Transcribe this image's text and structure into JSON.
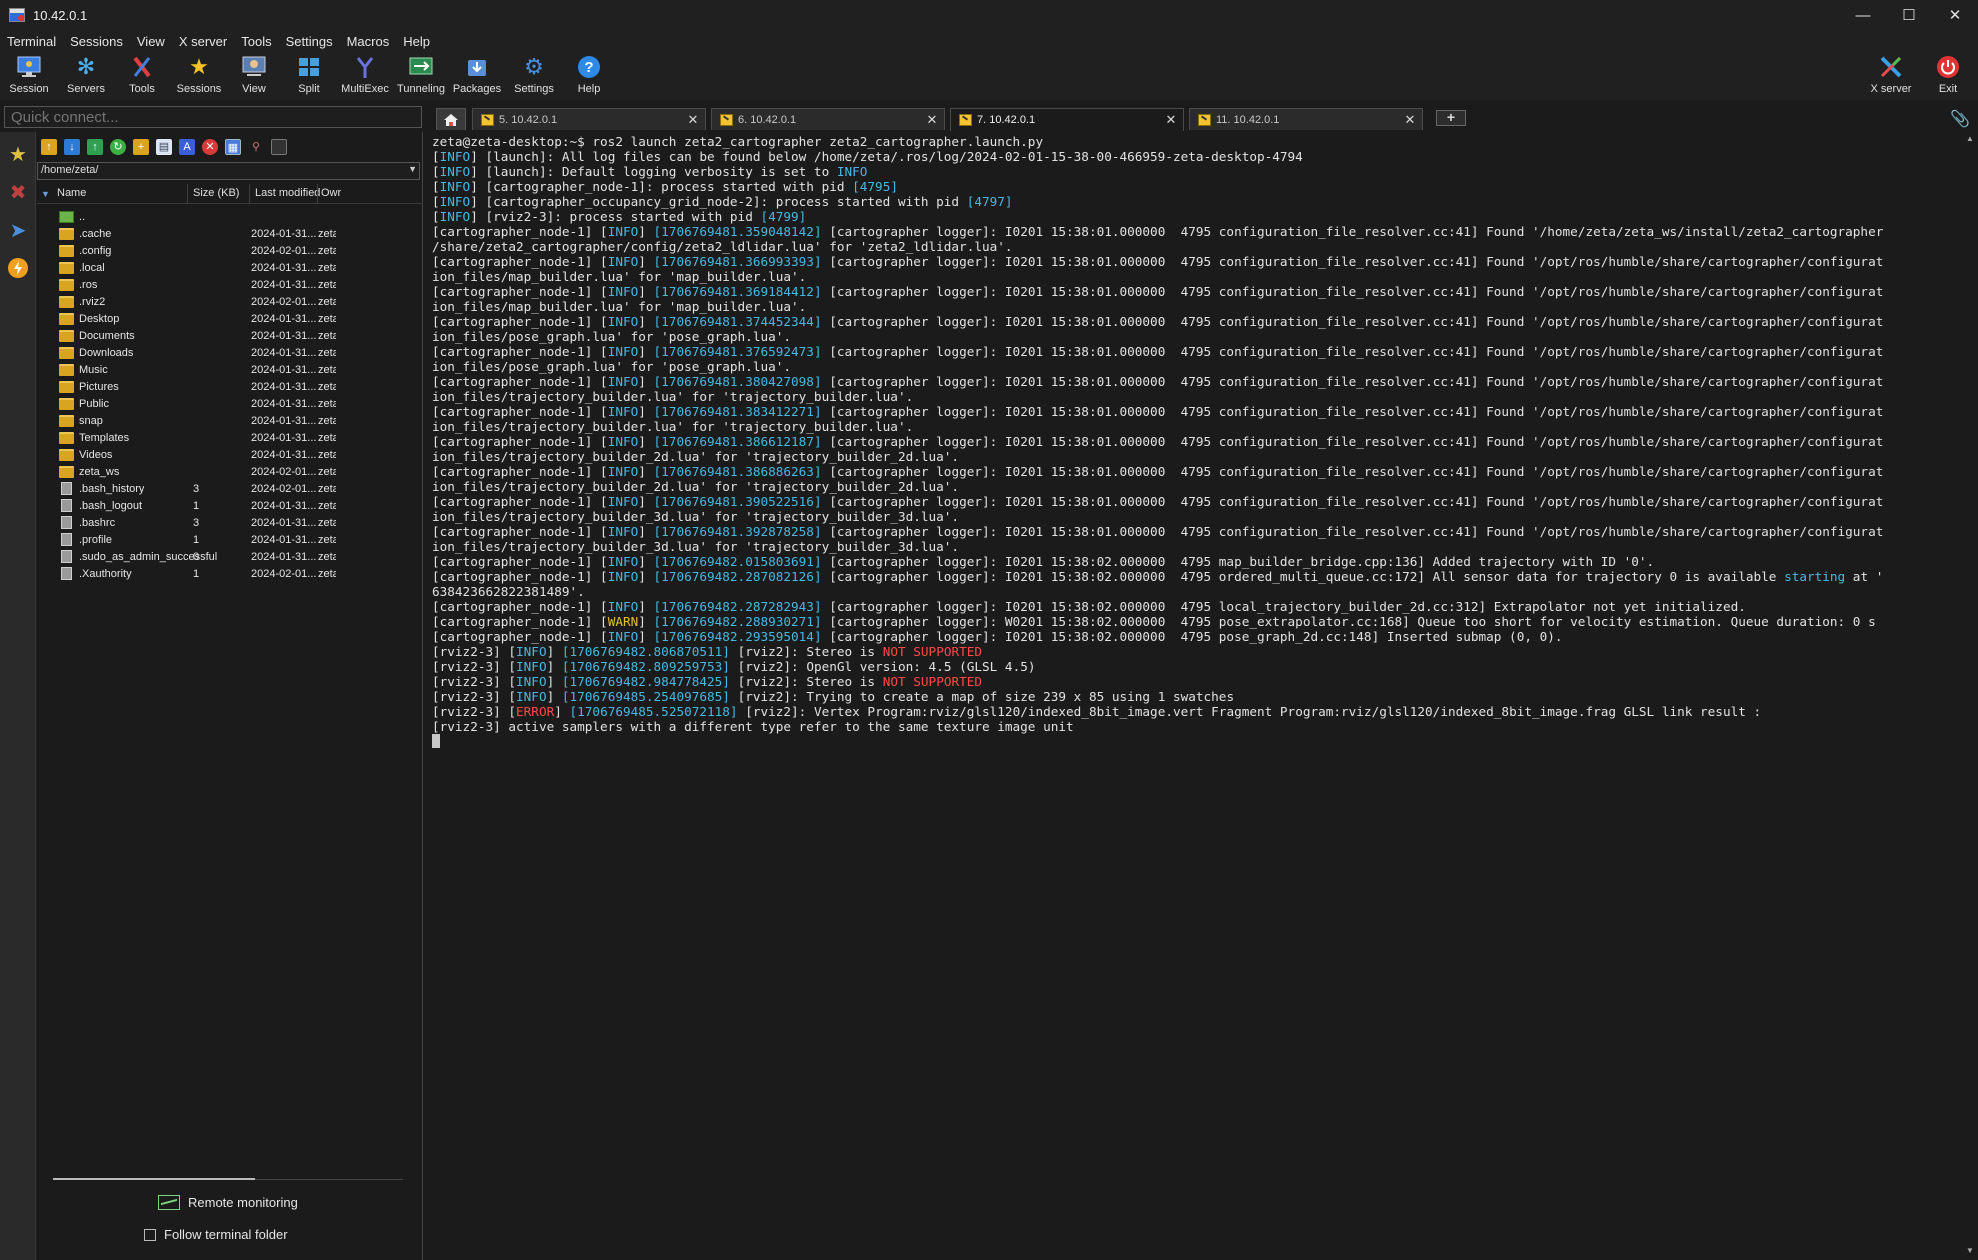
{
  "window": {
    "title": "10.42.0.1"
  },
  "menubar": [
    "Terminal",
    "Sessions",
    "View",
    "X server",
    "Tools",
    "Settings",
    "Macros",
    "Help"
  ],
  "toolbar": {
    "buttons": [
      {
        "label": "Session"
      },
      {
        "label": "Servers"
      },
      {
        "label": "Tools"
      },
      {
        "label": "Sessions"
      },
      {
        "label": "View"
      },
      {
        "label": "Split"
      },
      {
        "label": "MultiExec"
      },
      {
        "label": "Tunneling"
      },
      {
        "label": "Packages"
      },
      {
        "label": "Settings"
      },
      {
        "label": "Help"
      }
    ],
    "right_buttons": [
      {
        "label": "X server"
      },
      {
        "label": "Exit"
      }
    ]
  },
  "quick_connect": {
    "placeholder": "Quick connect..."
  },
  "tabs": [
    {
      "label": "5. 10.42.0.1",
      "active": false
    },
    {
      "label": "6. 10.42.0.1",
      "active": false
    },
    {
      "label": "7. 10.42.0.1",
      "active": true
    },
    {
      "label": "11. 10.42.0.1",
      "active": false
    }
  ],
  "sftp": {
    "path": "/home/zeta/",
    "columns": {
      "name": "Name",
      "size": "Size (KB)",
      "modified": "Last modified",
      "owner": "Owr"
    },
    "files": [
      {
        "name": "..",
        "size": "",
        "modified": "",
        "owner": "",
        "type": "up"
      },
      {
        "name": ".cache",
        "size": "",
        "modified": "2024-01-31...",
        "owner": "zeta",
        "type": "folder"
      },
      {
        "name": ".config",
        "size": "",
        "modified": "2024-02-01...",
        "owner": "zeta",
        "type": "folder"
      },
      {
        "name": ".local",
        "size": "",
        "modified": "2024-01-31...",
        "owner": "zeta",
        "type": "folder"
      },
      {
        "name": ".ros",
        "size": "",
        "modified": "2024-01-31...",
        "owner": "zeta",
        "type": "folder"
      },
      {
        "name": ".rviz2",
        "size": "",
        "modified": "2024-02-01...",
        "owner": "zeta",
        "type": "folder"
      },
      {
        "name": "Desktop",
        "size": "",
        "modified": "2024-01-31...",
        "owner": "zeta",
        "type": "folder"
      },
      {
        "name": "Documents",
        "size": "",
        "modified": "2024-01-31...",
        "owner": "zeta",
        "type": "folder"
      },
      {
        "name": "Downloads",
        "size": "",
        "modified": "2024-01-31...",
        "owner": "zeta",
        "type": "folder"
      },
      {
        "name": "Music",
        "size": "",
        "modified": "2024-01-31...",
        "owner": "zeta",
        "type": "folder"
      },
      {
        "name": "Pictures",
        "size": "",
        "modified": "2024-01-31...",
        "owner": "zeta",
        "type": "folder"
      },
      {
        "name": "Public",
        "size": "",
        "modified": "2024-01-31...",
        "owner": "zeta",
        "type": "folder"
      },
      {
        "name": "snap",
        "size": "",
        "modified": "2024-01-31...",
        "owner": "zeta",
        "type": "folder"
      },
      {
        "name": "Templates",
        "size": "",
        "modified": "2024-01-31...",
        "owner": "zeta",
        "type": "folder"
      },
      {
        "name": "Videos",
        "size": "",
        "modified": "2024-01-31...",
        "owner": "zeta",
        "type": "folder"
      },
      {
        "name": "zeta_ws",
        "size": "",
        "modified": "2024-02-01...",
        "owner": "zeta",
        "type": "folder"
      },
      {
        "name": ".bash_history",
        "size": "3",
        "modified": "2024-02-01...",
        "owner": "zeta",
        "type": "file"
      },
      {
        "name": ".bash_logout",
        "size": "1",
        "modified": "2024-01-31...",
        "owner": "zeta",
        "type": "file"
      },
      {
        "name": ".bashrc",
        "size": "3",
        "modified": "2024-01-31...",
        "owner": "zeta",
        "type": "file"
      },
      {
        "name": ".profile",
        "size": "1",
        "modified": "2024-01-31...",
        "owner": "zeta",
        "type": "file"
      },
      {
        "name": ".sudo_as_admin_successful",
        "size": "0",
        "modified": "2024-01-31...",
        "owner": "zeta",
        "type": "file"
      },
      {
        "name": ".Xauthority",
        "size": "1",
        "modified": "2024-02-01...",
        "owner": "zeta",
        "type": "file"
      }
    ],
    "remote_monitoring": "Remote monitoring",
    "follow_terminal_folder": "Follow terminal folder"
  },
  "colors": {
    "info": "#48b8e0",
    "warn": "#e0c030",
    "error": "#ff4848",
    "background": "#1b1b1b"
  },
  "terminal": {
    "lines": [
      [
        [
          "zeta@zeta-desktop:~$ ros2 launch zeta2_cartographer zeta2_cartographer.launch.py",
          ""
        ]
      ],
      [
        [
          "[",
          ""
        ],
        [
          "INFO",
          "info"
        ],
        [
          "] [launch]: All log files can be found below /home/zeta/.ros/log/2024-02-01-15-38-00-466959-zeta-desktop-4794",
          ""
        ]
      ],
      [
        [
          "[",
          ""
        ],
        [
          "INFO",
          "info"
        ],
        [
          "] [launch]: Default logging verbosity is set to ",
          ""
        ],
        [
          "INFO",
          "info"
        ]
      ],
      [
        [
          "[",
          ""
        ],
        [
          "INFO",
          "info"
        ],
        [
          "] [cartographer_node-1]: process started with pid ",
          ""
        ],
        [
          "[4795]",
          "cyan"
        ]
      ],
      [
        [
          "[",
          ""
        ],
        [
          "INFO",
          "info"
        ],
        [
          "] [cartographer_occupancy_grid_node-2]: process started with pid ",
          ""
        ],
        [
          "[4797]",
          "cyan"
        ]
      ],
      [
        [
          "[",
          ""
        ],
        [
          "INFO",
          "info"
        ],
        [
          "] [rviz2-3]: process started with pid ",
          ""
        ],
        [
          "[4799]",
          "cyan"
        ]
      ],
      [
        [
          "[cartographer_node-1] [",
          ""
        ],
        [
          "INFO",
          "info"
        ],
        [
          "] ",
          ""
        ],
        [
          "[1706769481.359048142]",
          "ts"
        ],
        [
          " [cartographer logger]: I0201 15:38:01.000000  4795 configuration_file_resolver.cc:41] Found '/home/zeta/zeta_ws/install/zeta2_cartographer",
          ""
        ]
      ],
      [
        [
          "/share/zeta2_cartographer/config/zeta2_ldlidar.lua' for 'zeta2_ldlidar.lua'.",
          ""
        ]
      ],
      [
        [
          "[cartographer_node-1] [",
          ""
        ],
        [
          "INFO",
          "info"
        ],
        [
          "] ",
          ""
        ],
        [
          "[1706769481.366993393]",
          "ts"
        ],
        [
          " [cartographer logger]: I0201 15:38:01.000000  4795 configuration_file_resolver.cc:41] Found '/opt/ros/humble/share/cartographer/configurat",
          ""
        ]
      ],
      [
        [
          "ion_files/map_builder.lua' for 'map_builder.lua'.",
          ""
        ]
      ],
      [
        [
          "[cartographer_node-1] [",
          ""
        ],
        [
          "INFO",
          "info"
        ],
        [
          "] ",
          ""
        ],
        [
          "[1706769481.369184412]",
          "ts"
        ],
        [
          " [cartographer logger]: I0201 15:38:01.000000  4795 configuration_file_resolver.cc:41] Found '/opt/ros/humble/share/cartographer/configurat",
          ""
        ]
      ],
      [
        [
          "ion_files/map_builder.lua' for 'map_builder.lua'.",
          ""
        ]
      ],
      [
        [
          "[cartographer_node-1] [",
          ""
        ],
        [
          "INFO",
          "info"
        ],
        [
          "] ",
          ""
        ],
        [
          "[1706769481.374452344]",
          "ts"
        ],
        [
          " [cartographer logger]: I0201 15:38:01.000000  4795 configuration_file_resolver.cc:41] Found '/opt/ros/humble/share/cartographer/configurat",
          ""
        ]
      ],
      [
        [
          "ion_files/pose_graph.lua' for 'pose_graph.lua'.",
          ""
        ]
      ],
      [
        [
          "[cartographer_node-1] [",
          ""
        ],
        [
          "INFO",
          "info"
        ],
        [
          "] ",
          ""
        ],
        [
          "[1706769481.376592473]",
          "ts"
        ],
        [
          " [cartographer logger]: I0201 15:38:01.000000  4795 configuration_file_resolver.cc:41] Found '/opt/ros/humble/share/cartographer/configurat",
          ""
        ]
      ],
      [
        [
          "ion_files/pose_graph.lua' for 'pose_graph.lua'.",
          ""
        ]
      ],
      [
        [
          "[cartographer_node-1] [",
          ""
        ],
        [
          "INFO",
          "info"
        ],
        [
          "] ",
          ""
        ],
        [
          "[1706769481.380427098]",
          "ts"
        ],
        [
          " [cartographer logger]: I0201 15:38:01.000000  4795 configuration_file_resolver.cc:41] Found '/opt/ros/humble/share/cartographer/configurat",
          ""
        ]
      ],
      [
        [
          "ion_files/trajectory_builder.lua' for 'trajectory_builder.lua'.",
          ""
        ]
      ],
      [
        [
          "[cartographer_node-1] [",
          ""
        ],
        [
          "INFO",
          "info"
        ],
        [
          "] ",
          ""
        ],
        [
          "[1706769481.383412271]",
          "ts"
        ],
        [
          " [cartographer logger]: I0201 15:38:01.000000  4795 configuration_file_resolver.cc:41] Found '/opt/ros/humble/share/cartographer/configurat",
          ""
        ]
      ],
      [
        [
          "ion_files/trajectory_builder.lua' for 'trajectory_builder.lua'.",
          ""
        ]
      ],
      [
        [
          "[cartographer_node-1] [",
          ""
        ],
        [
          "INFO",
          "info"
        ],
        [
          "] ",
          ""
        ],
        [
          "[1706769481.386612187]",
          "ts"
        ],
        [
          " [cartographer logger]: I0201 15:38:01.000000  4795 configuration_file_resolver.cc:41] Found '/opt/ros/humble/share/cartographer/configurat",
          ""
        ]
      ],
      [
        [
          "ion_files/trajectory_builder_2d.lua' for 'trajectory_builder_2d.lua'.",
          ""
        ]
      ],
      [
        [
          "[cartographer_node-1] [",
          ""
        ],
        [
          "INFO",
          "info"
        ],
        [
          "] ",
          ""
        ],
        [
          "[1706769481.386886263]",
          "ts"
        ],
        [
          " [cartographer logger]: I0201 15:38:01.000000  4795 configuration_file_resolver.cc:41] Found '/opt/ros/humble/share/cartographer/configurat",
          ""
        ]
      ],
      [
        [
          "ion_files/trajectory_builder_2d.lua' for 'trajectory_builder_2d.lua'.",
          ""
        ]
      ],
      [
        [
          "[cartographer_node-1] [",
          ""
        ],
        [
          "INFO",
          "info"
        ],
        [
          "] ",
          ""
        ],
        [
          "[1706769481.390522516]",
          "ts"
        ],
        [
          " [cartographer logger]: I0201 15:38:01.000000  4795 configuration_file_resolver.cc:41] Found '/opt/ros/humble/share/cartographer/configurat",
          ""
        ]
      ],
      [
        [
          "ion_files/trajectory_builder_3d.lua' for 'trajectory_builder_3d.lua'.",
          ""
        ]
      ],
      [
        [
          "[cartographer_node-1] [",
          ""
        ],
        [
          "INFO",
          "info"
        ],
        [
          "] ",
          ""
        ],
        [
          "[1706769481.392878258]",
          "ts"
        ],
        [
          " [cartographer logger]: I0201 15:38:01.000000  4795 configuration_file_resolver.cc:41] Found '/opt/ros/humble/share/cartographer/configurat",
          ""
        ]
      ],
      [
        [
          "ion_files/trajectory_builder_3d.lua' for 'trajectory_builder_3d.lua'.",
          ""
        ]
      ],
      [
        [
          "[cartographer_node-1] [",
          ""
        ],
        [
          "INFO",
          "info"
        ],
        [
          "] ",
          ""
        ],
        [
          "[1706769482.015803691]",
          "ts"
        ],
        [
          " [cartographer logger]: I0201 15:38:02.000000  4795 map_builder_bridge.cpp:136] Added trajectory with ID '0'.",
          ""
        ]
      ],
      [
        [
          "[cartographer_node-1] [",
          ""
        ],
        [
          "INFO",
          "info"
        ],
        [
          "] ",
          ""
        ],
        [
          "[1706769482.287082126]",
          "ts"
        ],
        [
          " [cartographer logger]: I0201 15:38:02.000000  4795 ordered_multi_queue.cc:172] All sensor data for trajectory 0 is available ",
          ""
        ],
        [
          "starting",
          "cyan"
        ],
        [
          " at '",
          ""
        ]
      ],
      [
        [
          "638423662822381489'.",
          ""
        ]
      ],
      [
        [
          "[cartographer_node-1] [",
          ""
        ],
        [
          "INFO",
          "info"
        ],
        [
          "] ",
          ""
        ],
        [
          "[1706769482.287282943]",
          "ts"
        ],
        [
          " [cartographer logger]: I0201 15:38:02.000000  4795 local_trajectory_builder_2d.cc:312] Extrapolator not yet initialized.",
          ""
        ]
      ],
      [
        [
          "[cartographer_node-1] [",
          ""
        ],
        [
          "WARN",
          "warn"
        ],
        [
          "] ",
          ""
        ],
        [
          "[1706769482.288930271]",
          "ts"
        ],
        [
          " [cartographer logger]: W0201 15:38:02.000000  4795 pose_extrapolator.cc:168] Queue too short for velocity estimation. Queue duration: 0 s",
          ""
        ]
      ],
      [
        [
          "[cartographer_node-1] [",
          ""
        ],
        [
          "INFO",
          "info"
        ],
        [
          "] ",
          ""
        ],
        [
          "[1706769482.293595014]",
          "ts"
        ],
        [
          " [cartographer logger]: I0201 15:38:02.000000  4795 pose_graph_2d.cc:148] Inserted submap (0, 0).",
          ""
        ]
      ],
      [
        [
          "[rviz2-3] [",
          ""
        ],
        [
          "INFO",
          "info"
        ],
        [
          "] ",
          ""
        ],
        [
          "[1706769482.806870511]",
          "ts"
        ],
        [
          " [rviz2]: Stereo is ",
          ""
        ],
        [
          "NOT SUPPORTED",
          "red"
        ]
      ],
      [
        [
          "[rviz2-3] [",
          ""
        ],
        [
          "INFO",
          "info"
        ],
        [
          "] ",
          ""
        ],
        [
          "[1706769482.809259753]",
          "ts"
        ],
        [
          " [rviz2]: OpenGl version: 4.5 (GLSL 4.5)",
          ""
        ]
      ],
      [
        [
          "[rviz2-3] [",
          ""
        ],
        [
          "INFO",
          "info"
        ],
        [
          "] ",
          ""
        ],
        [
          "[1706769482.984778425]",
          "ts"
        ],
        [
          " [rviz2]: Stereo is ",
          ""
        ],
        [
          "NOT SUPPORTED",
          "red"
        ]
      ],
      [
        [
          "[rviz2-3] [",
          ""
        ],
        [
          "INFO",
          "info"
        ],
        [
          "] ",
          ""
        ],
        [
          "[1706769485.254097685]",
          "ts"
        ],
        [
          " [rviz2]: Trying to create a map of size 239 x 85 using 1 swatches",
          ""
        ]
      ],
      [
        [
          "[rviz2-3] [",
          ""
        ],
        [
          "ERROR",
          "err"
        ],
        [
          "] ",
          ""
        ],
        [
          "[1706769485.525072118]",
          "ts"
        ],
        [
          " [rviz2]: Vertex Program:rviz/glsl120/indexed_8bit_image.vert Fragment Program:rviz/glsl120/indexed_8bit_image.frag GLSL link result :",
          ""
        ]
      ],
      [
        [
          "[rviz2-3] active samplers with a different type refer to the same texture image unit",
          ""
        ]
      ]
    ]
  }
}
